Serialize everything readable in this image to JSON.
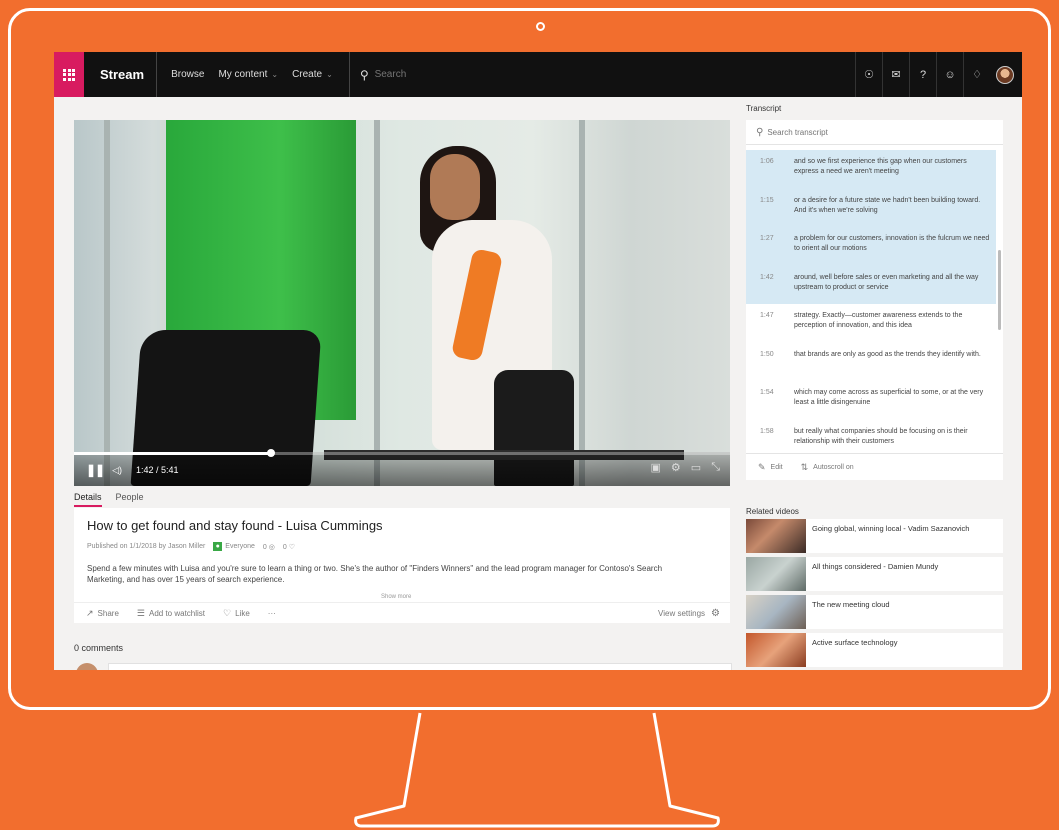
{
  "app": {
    "brand": "Stream",
    "nav": [
      {
        "label": "Browse"
      },
      {
        "label": "My content"
      },
      {
        "label": "Create"
      }
    ],
    "search_placeholder": "Search",
    "accent_color": "#d81b60",
    "top_icons": [
      "pin-icon",
      "mail-icon",
      "help-icon",
      "emoji-icon",
      "bell-icon"
    ],
    "help_glyph": "?"
  },
  "player": {
    "time": "1:42 / 5:41",
    "progress": 0.3
  },
  "tabs": [
    {
      "label": "Details"
    },
    {
      "label": "People"
    }
  ],
  "video": {
    "title": "How to get found and stay found - Luisa Cummings",
    "published": "Published on 1/1/2018 by Jason Miller",
    "audience": "Everyone",
    "views": "0",
    "likes": "0",
    "description": "Spend a few minutes with Luisa and you're sure to learn a thing or two. She's the author of \"Finders Winners\" and the lead program manager for Contoso's Search Marketing, and has over 15 years of search experience.",
    "show_more": "Show more",
    "actions": {
      "share": "Share",
      "watchlist": "Add to watchlist",
      "like": "Like",
      "more": "···",
      "settings": "View settings"
    }
  },
  "comments": {
    "title": "0 comments"
  },
  "transcript": {
    "title": "Transcript",
    "search_placeholder": "Search transcript",
    "items": [
      {
        "time": "1:06",
        "text": "and so we first experience this gap when our customers express a need we aren't meeting",
        "hl": true
      },
      {
        "time": "1:15",
        "text": "or a desire for a future state we hadn't been building toward. And it's when we're solving",
        "hl": true
      },
      {
        "time": "1:27",
        "text": "a problem for our customers, innovation is the fulcrum we need to orient all our motions",
        "hl": true
      },
      {
        "time": "1:42",
        "text": "around, well before sales or even marketing and all the way upstream to product or service",
        "hl": true
      },
      {
        "time": "1:47",
        "text": "strategy. Exactly—customer awareness extends to the perception of innovation, and this idea",
        "hl": false
      },
      {
        "time": "1:50",
        "text": "that brands are only as good as the trends they identify with.",
        "hl": false
      },
      {
        "time": "1:54",
        "text": "which may come across as superficial to some, or at the very least a little disingenuine",
        "hl": false
      },
      {
        "time": "1:58",
        "text": "but really what companies should be focusing on is their relationship with their customers",
        "hl": false
      }
    ],
    "edit": "Edit",
    "autoscroll": "Autoscroll on"
  },
  "related": {
    "title": "Related videos",
    "items": [
      {
        "title": "Going global, winning local - Vadim Sazanovich"
      },
      {
        "title": "All things considered - Damien Mundy"
      },
      {
        "title": "The new meeting cloud"
      },
      {
        "title": "Active surface technology"
      }
    ]
  }
}
